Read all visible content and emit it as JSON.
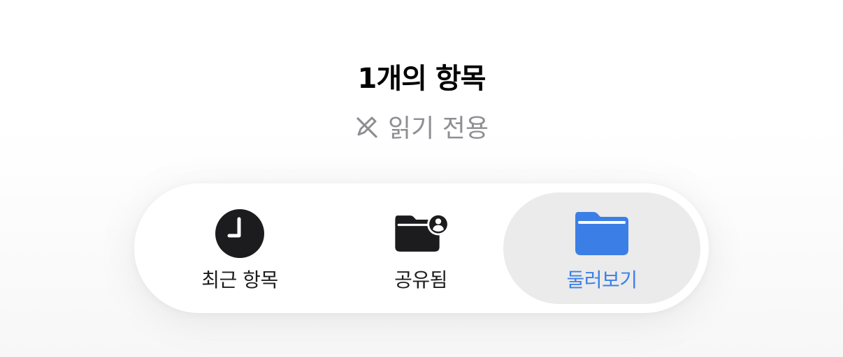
{
  "header": {
    "item_count": "1개의 항목",
    "status": "읽기 전용",
    "status_icon": "pencil-slash-icon"
  },
  "tabbar": {
    "tabs": [
      {
        "label": "최근 항목",
        "icon": "clock-icon",
        "selected": false
      },
      {
        "label": "공유됨",
        "icon": "shared-folder-icon",
        "selected": false
      },
      {
        "label": "둘러보기",
        "icon": "folder-icon",
        "selected": true
      }
    ]
  },
  "colors": {
    "accent": "#3b7fe6",
    "text_primary": "#000000",
    "text_secondary": "#8e8e93",
    "selected_tab_bg": "#ebebeb"
  }
}
